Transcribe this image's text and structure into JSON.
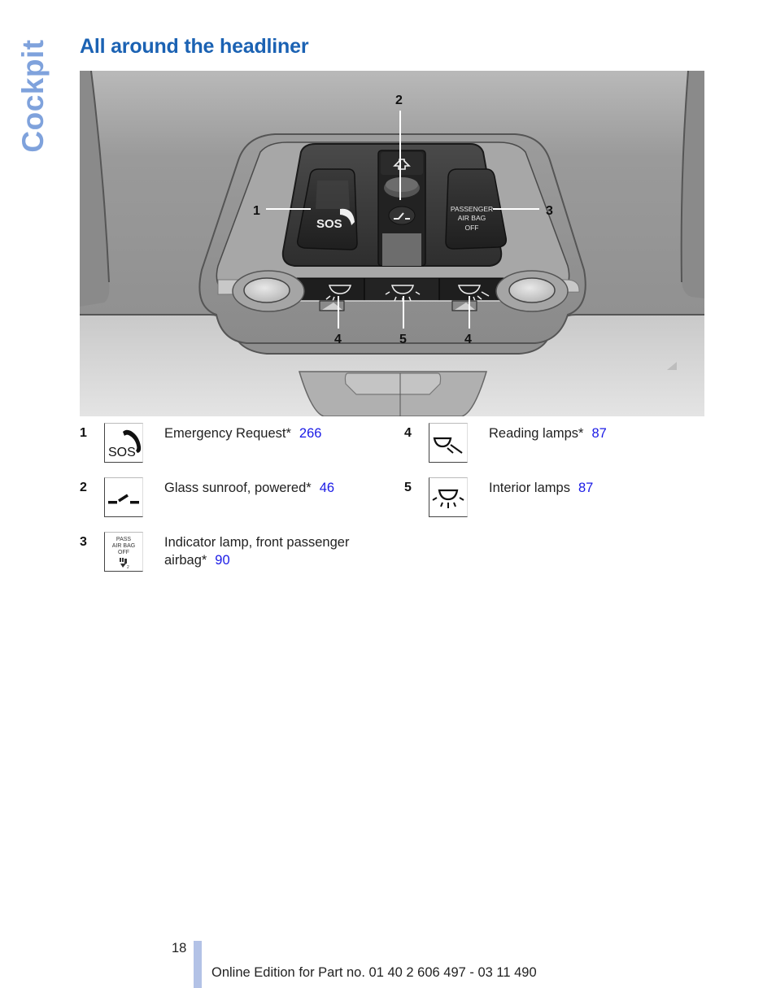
{
  "section_tab": "Cockpit",
  "title": "All around the headliner",
  "figure": {
    "alt": "Overhead console with SOS button, glass sunroof switch, passenger airbag off indicator, reading and interior lamp buttons",
    "labels": {
      "sos_button": "SOS",
      "airbag_indicator": [
        "PASSENGER",
        "AIR BAG",
        "OFF"
      ]
    },
    "callouts": [
      "1",
      "2",
      "3",
      "4",
      "5",
      "4"
    ]
  },
  "legend": [
    {
      "number": "1",
      "icon": "sos-phone-icon",
      "text": "Emergency Request*",
      "page": "266"
    },
    {
      "number": "2",
      "icon": "sunroof-switch-icon",
      "text": "Glass sunroof, powered*",
      "page": "46"
    },
    {
      "number": "3",
      "icon": "passenger-airbag-off-icon",
      "icon_text": [
        "PASS",
        "AIR BAG",
        "OFF"
      ],
      "text": "Indicator lamp, front passenger airbag*",
      "page": "90"
    },
    {
      "number": "4",
      "icon": "reading-lamp-icon",
      "text": "Reading lamps*",
      "page": "87"
    },
    {
      "number": "5",
      "icon": "interior-lamp-icon",
      "text": "Interior lamps",
      "page": "87"
    }
  ],
  "footer": {
    "page_number": "18",
    "edition": "Online Edition for Part no. 01 40 2 606 497 - 03 11 490"
  },
  "colors": {
    "title": "#1b62b3",
    "side_tab": "#7fa2dc",
    "page_link": "#1a1ae6",
    "footer_bar": "#b3c2e6"
  }
}
